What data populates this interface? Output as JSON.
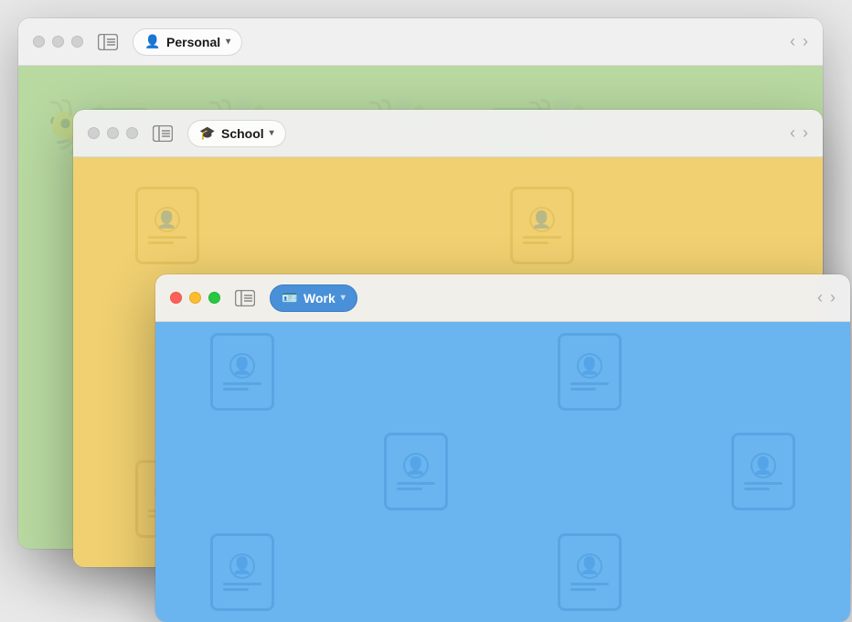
{
  "windows": {
    "personal": {
      "title": "Personal",
      "icon": "👤",
      "z_index": 1,
      "active": false,
      "bg_color": "#b8d9a0",
      "pattern_color": "#7cb86a"
    },
    "school": {
      "title": "School",
      "icon": "🎓",
      "z_index": 2,
      "active": false,
      "bg_color": "#f0d070",
      "pattern_color": "#c8a030"
    },
    "work": {
      "title": "Work",
      "icon": "🪪",
      "z_index": 3,
      "active": true,
      "bg_color": "#6ab4f0",
      "pattern_color": "#2a7abf"
    }
  },
  "nav": {
    "back_label": "‹",
    "forward_label": "›"
  },
  "sidebar_icon": "sidebar",
  "traffic_lights": {
    "close": "#ff5f57",
    "minimize": "#febc2e",
    "maximize": "#28c840",
    "inactive": "#d0d0d0"
  }
}
